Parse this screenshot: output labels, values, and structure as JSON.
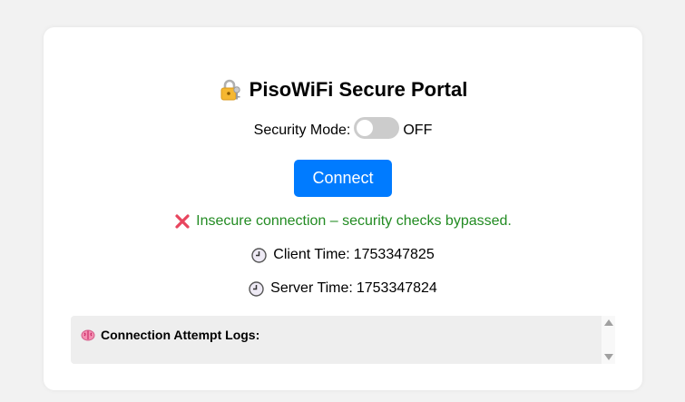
{
  "portal": {
    "title": "PisoWiFi Secure Portal",
    "title_icon": "lock-with-key-icon"
  },
  "security": {
    "label": "Security Mode:",
    "state": "OFF",
    "toggle_on": false
  },
  "connect_button": {
    "label": "Connect",
    "color": "#007bff"
  },
  "status": {
    "icon": "cross-mark-icon",
    "message": "Insecure connection – security checks bypassed.",
    "color": "#228b22"
  },
  "times": {
    "client_label": "Client Time:",
    "client_value": "1753347825",
    "server_label": "Server Time:",
    "server_value": "1753347824",
    "icon": "clock-icon"
  },
  "logs": {
    "icon": "brain-icon",
    "header": "Connection Attempt Logs:"
  }
}
